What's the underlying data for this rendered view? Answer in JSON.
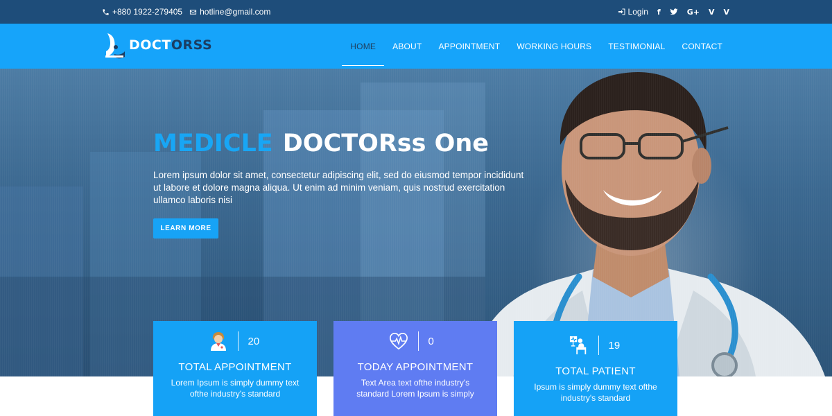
{
  "topbar": {
    "phone": "+880 1922-279405",
    "email": "hotline@gmail.com",
    "login_label": "Login",
    "social": [
      "facebook-icon",
      "twitter-icon",
      "google-plus-icon",
      "vimeo-icon",
      "vine-icon"
    ]
  },
  "brand": {
    "part1": "DOCT",
    "part2": "ORSS"
  },
  "nav": {
    "items": [
      {
        "label": "HOME",
        "active": true
      },
      {
        "label": "ABOUT"
      },
      {
        "label": "APPOINTMENT"
      },
      {
        "label": "WORKING HOURS"
      },
      {
        "label": "TESTIMONIAL"
      },
      {
        "label": "CONTACT"
      }
    ]
  },
  "hero": {
    "title_accent": "MEDICLE",
    "title_rest": "DOCTORss One",
    "description": "Lorem ipsum dolor sit amet, consectetur adipiscing elit, sed do eiusmod tempor incididunt ut labore et dolore magna aliqua. Ut enim ad minim veniam, quis nostrud exercitation ullamco laboris nisi",
    "cta_label": "LEARN MORE"
  },
  "stats": [
    {
      "number": "20",
      "label": "TOTAL APPOINTMENT",
      "text": "Lorem Ipsum is simply dummy text ofthe industry's standard",
      "icon": "doctor-woman-icon"
    },
    {
      "number": "0",
      "label": "TODAY APPOINTMENT",
      "text": "Text Area text ofthe industry's standard Lorem Ipsum is simply",
      "icon": "heartbeat-icon"
    },
    {
      "number": "19",
      "label": "TOTAL PATIENT",
      "text": "Ipsum is simply dummy text ofthe industry's standard",
      "icon": "patient-bed-icon"
    }
  ],
  "colors": {
    "topbar": "#1e4d7a",
    "nav": "#16a4fa",
    "accent": "#18a6f5",
    "card_blue": "#15a2f6",
    "card_purple": "#5f7cf2"
  }
}
